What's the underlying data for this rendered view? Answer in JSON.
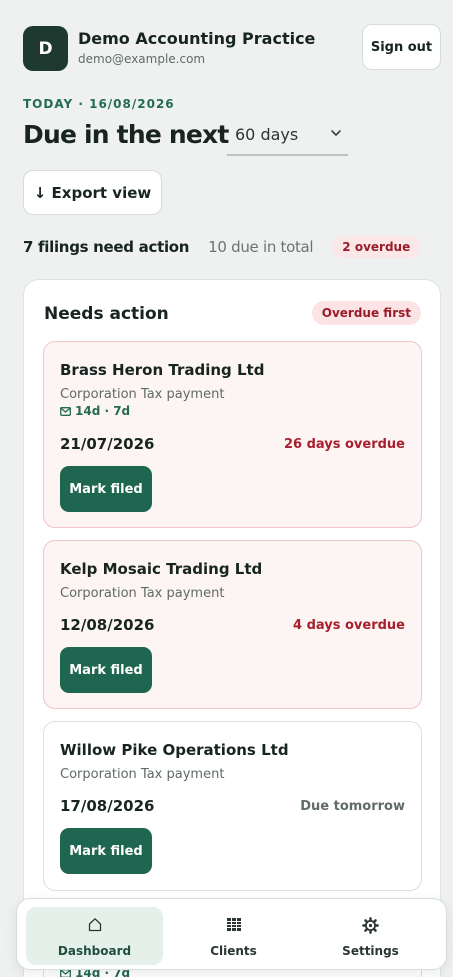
{
  "header": {
    "avatar_initial": "D",
    "practice_name": "Demo Accounting Practice",
    "email": "demo@example.com",
    "signout_label": "Sign out"
  },
  "today_label": "TODAY · 16/08/2026",
  "due_title": "Due in the next",
  "range": {
    "selected": "60 days"
  },
  "export_label": "↓ Export view",
  "summary": {
    "need_action": "7 filings need action",
    "total": "10 due in total",
    "overdue": "2 overdue"
  },
  "panel": {
    "title": "Needs action",
    "sort_label": "Overdue first",
    "cards": [
      {
        "client": "Brass Heron Trading Ltd",
        "type": "Corporation Tax payment",
        "reminder": "14d · 7d",
        "date": "21/07/2026",
        "status": "26 days overdue",
        "button": "Mark filed"
      },
      {
        "client": "Kelp Mosaic Trading Ltd",
        "type": "Corporation Tax payment",
        "date": "12/08/2026",
        "status": "4 days overdue",
        "button": "Mark filed"
      },
      {
        "client": "Willow Pike Operations Ltd",
        "type": "Corporation Tax payment",
        "date": "17/08/2026",
        "status": "Due tomorrow",
        "button": "Mark filed"
      }
    ],
    "partial_reminder": "14d · 7d"
  },
  "nav": {
    "items": [
      {
        "label": "Dashboard",
        "icon": "home-icon"
      },
      {
        "label": "Clients",
        "icon": "grid-icon"
      },
      {
        "label": "Settings",
        "icon": "gear-icon"
      }
    ],
    "active": "Dashboard"
  },
  "colors": {
    "background": "#eef1ef",
    "accent": "#1f6650",
    "overdue_red": "#a8202e",
    "overdue_card_bg": "#fdf4f4"
  }
}
